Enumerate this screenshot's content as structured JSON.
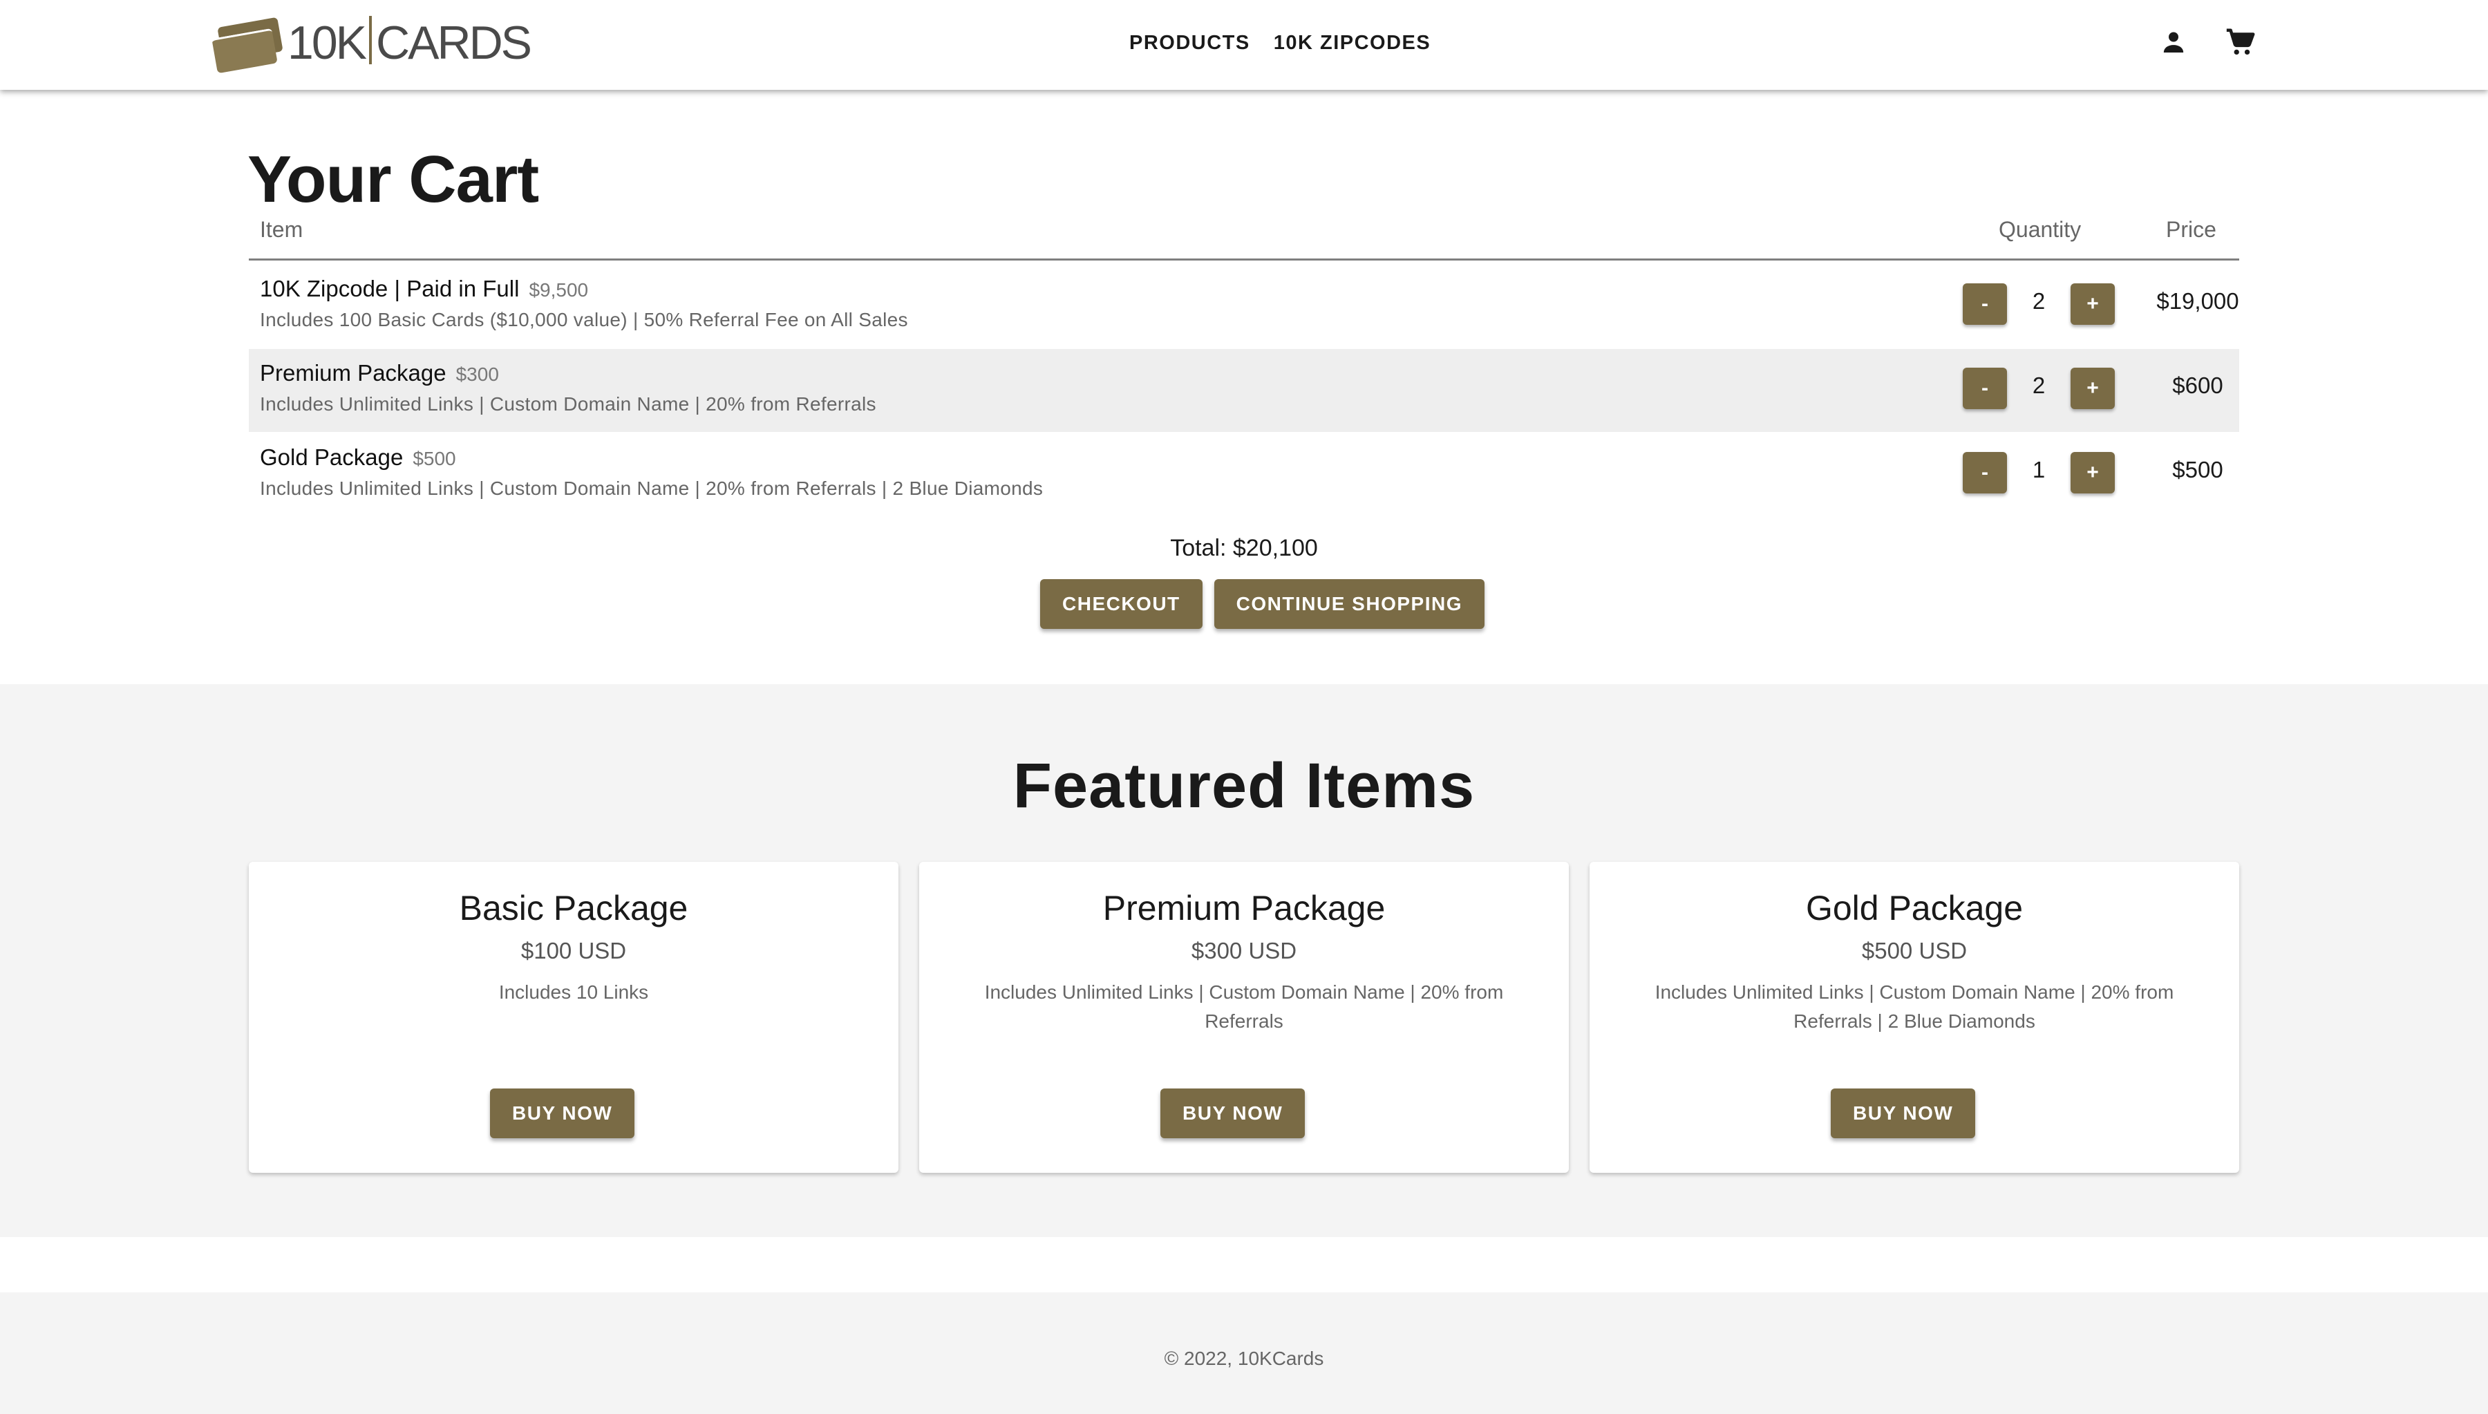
{
  "header": {
    "logo_text_left": "10K",
    "logo_text_right": "CARDS",
    "nav": [
      "PRODUCTS",
      "10K ZIPCODES"
    ],
    "icons": [
      "account-icon",
      "cart-icon"
    ]
  },
  "cart": {
    "title": "Your Cart",
    "columns": {
      "item": "Item",
      "quantity": "Quantity",
      "price": "Price"
    },
    "rows": [
      {
        "name": "10K Zipcode | Paid in Full",
        "unit_price": "$9,500",
        "description": "Includes 100 Basic Cards ($10,000 value) | 50% Referral Fee on All Sales",
        "quantity": "2",
        "price": "$19,000"
      },
      {
        "name": "Premium Package",
        "unit_price": "$300",
        "description": "Includes Unlimited Links | Custom Domain Name | 20% from Referrals",
        "quantity": "2",
        "price": "$600"
      },
      {
        "name": "Gold Package",
        "unit_price": "$500",
        "description": "Includes Unlimited Links | Custom Domain Name | 20% from Referrals | 2 Blue Diamonds",
        "quantity": "1",
        "price": "$500"
      }
    ],
    "minus_label": "-",
    "plus_label": "+",
    "total": "Total: $20,100",
    "checkout_label": "CHECKOUT",
    "continue_label": "CONTINUE SHOPPING"
  },
  "featured": {
    "title": "Featured Items",
    "cards": [
      {
        "name": "Basic Package",
        "price": "$100 USD",
        "description": "Includes 10 Links",
        "button": "BUY NOW"
      },
      {
        "name": "Premium Package",
        "price": "$300 USD",
        "description": "Includes Unlimited Links | Custom Domain Name | 20% from Referrals",
        "button": "BUY NOW"
      },
      {
        "name": "Gold Package",
        "price": "$500 USD",
        "description": "Includes Unlimited Links | Custom Domain Name | 20% from Referrals | 2 Blue Diamonds",
        "button": "BUY NOW"
      }
    ]
  },
  "footer": {
    "text": "© 2022, 10KCards"
  },
  "colors": {
    "accent": "#7a6b45",
    "band": "#f4f4f4",
    "row_alt": "#eeeeee"
  }
}
